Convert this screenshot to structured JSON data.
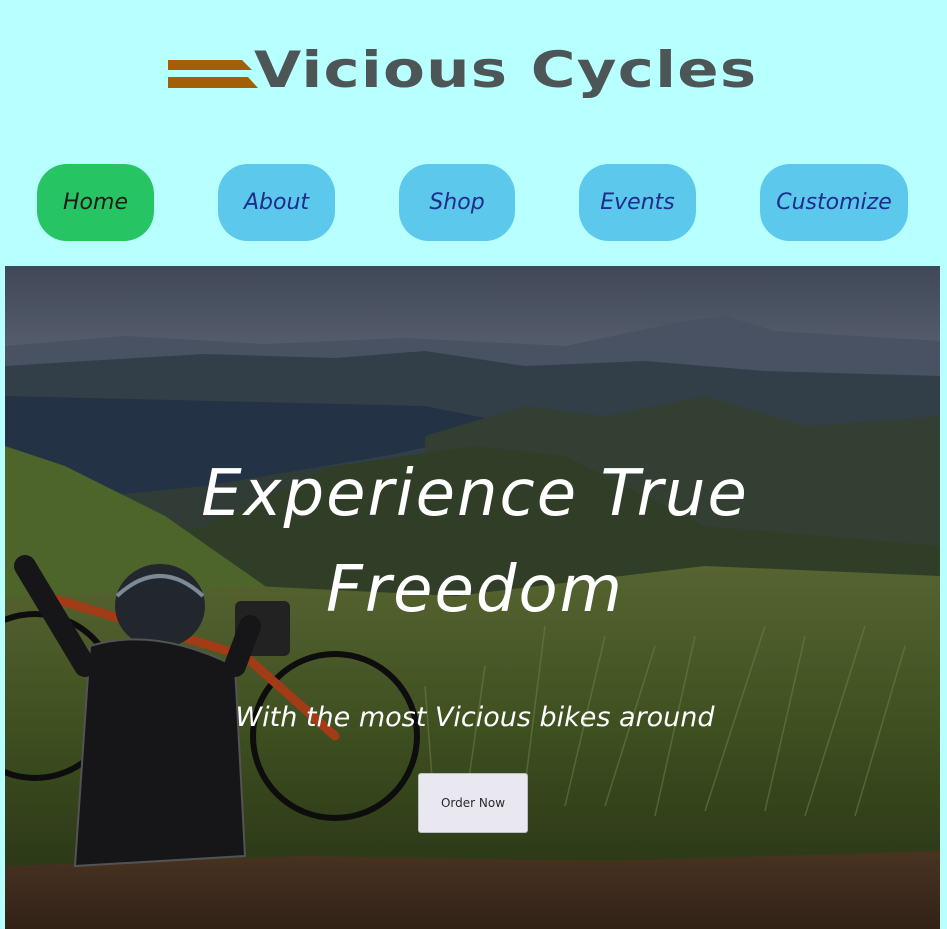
{
  "brand": {
    "name": "Vicious Cycles",
    "stripe_color": "#a35f08",
    "text_color": "#4d5656"
  },
  "nav": {
    "items": [
      {
        "label": "Home",
        "active": true
      },
      {
        "label": "About",
        "active": false
      },
      {
        "label": "Shop",
        "active": false
      },
      {
        "label": "Events",
        "active": false
      },
      {
        "label": "Customize",
        "active": false
      }
    ],
    "colors": {
      "default_bg": "#5bc8ec",
      "active_bg": "#26c462",
      "default_text": "#1f2c8a"
    }
  },
  "hero": {
    "title": "Experience True Freedom",
    "subtitle": "With the most Vicious bikes around",
    "cta_label": "Order Now"
  },
  "page": {
    "background": "#b8ffff"
  }
}
